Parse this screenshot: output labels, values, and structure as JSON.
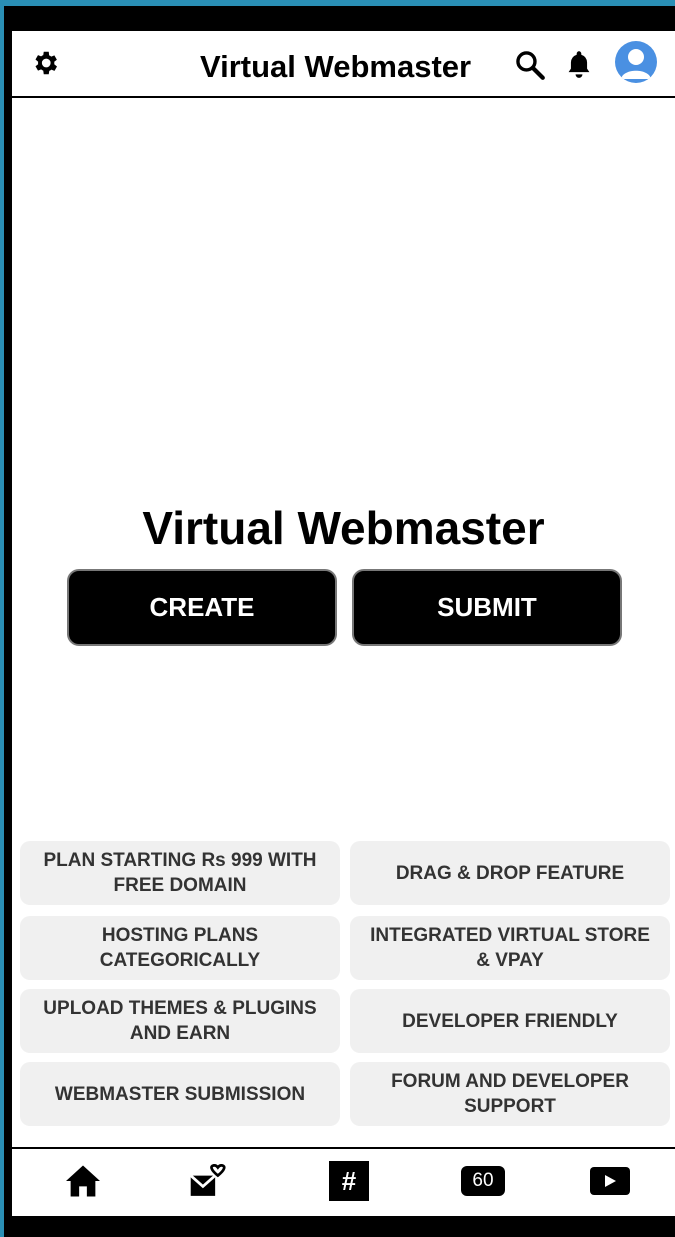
{
  "header": {
    "title": "Virtual Webmaster",
    "icons": [
      "gear-icon",
      "search-icon",
      "bell-icon",
      "user-avatar-icon"
    ],
    "avatar_color": "#4a90e2"
  },
  "hero": {
    "title": "Virtual Webmaster",
    "create_label": "CREATE",
    "submit_label": "SUBMIT"
  },
  "features": [
    "PLAN STARTING Rs 999 WITH FREE DOMAIN",
    "DRAG & DROP FEATURE",
    "HOSTING PLANS CATEGORICALLY",
    "INTEGRATED VIRTUAL STORE & VPAY",
    "UPLOAD THEMES & PLUGINS AND EARN",
    "DEVELOPER FRIENDLY",
    "WEBMASTER SUBMISSION",
    "FORUM AND DEVELOPER SUPPORT"
  ],
  "nav": {
    "icons": [
      "home-icon",
      "mail-heart-icon",
      "hashtag-icon",
      "sixty-icon",
      "play-icon"
    ],
    "hash_label": "#",
    "sixty_label": "60"
  }
}
